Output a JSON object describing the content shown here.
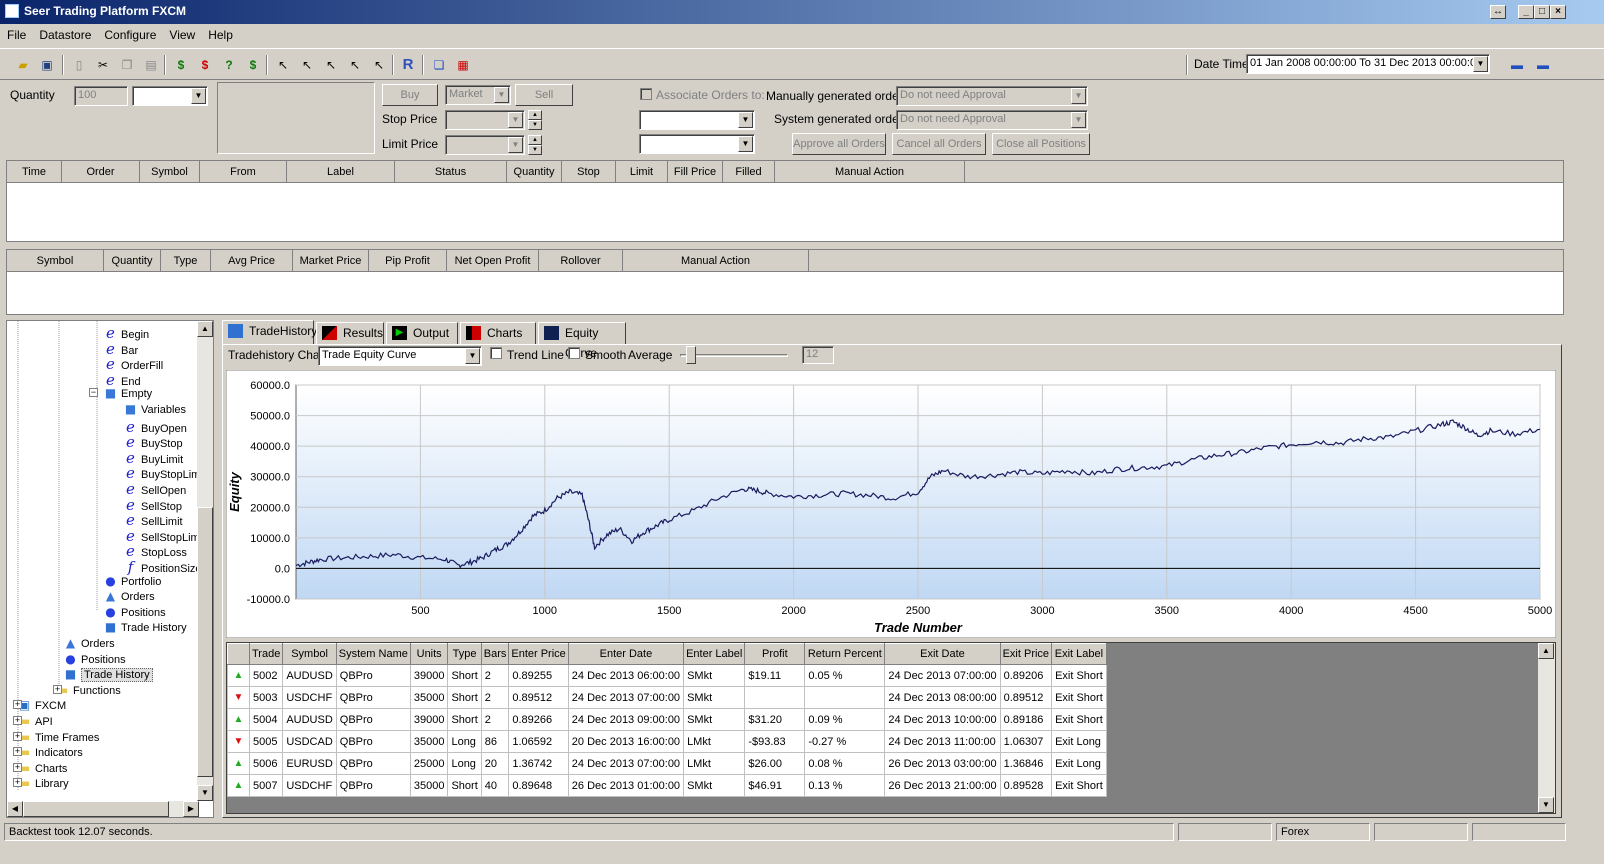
{
  "window": {
    "title": "Seer Trading Platform FXCM"
  },
  "menu": [
    "File",
    "Datastore",
    "Configure",
    "View",
    "Help"
  ],
  "datetime": {
    "label": "Date Time",
    "value": "01 Jan 2008 00:00:00 To 31 Dec 2013 00:00:00"
  },
  "order_entry": {
    "quantity_label": "Quantity",
    "quantity_value": "100",
    "buy_label": "Buy",
    "sell_label": "Sell",
    "order_type": "Market",
    "stop_price_label": "Stop Price",
    "limit_price_label": "Limit Price",
    "associate_label": "Associate Orders to:",
    "manual_label": "Manually generated orders",
    "manual_value": "Do not need Approval",
    "system_label": "System generated orders",
    "system_value": "Do not need Approval",
    "approve_label": "Approve all Orders",
    "cancel_label": "Cancel all Orders",
    "close_label": "Close all Positions"
  },
  "orders_grid": {
    "columns": [
      "Time",
      "Order",
      "Symbol",
      "From",
      "Label",
      "Status",
      "Quantity",
      "Stop",
      "Limit",
      "Fill Price",
      "Filled",
      "Manual Action"
    ]
  },
  "positions_grid": {
    "columns": [
      "Symbol",
      "Quantity",
      "Type",
      "Avg Price",
      "Market Price",
      "Pip Profit",
      "Net Open Profit",
      "Rollover",
      "Manual Action"
    ]
  },
  "tree": {
    "items": [
      {
        "label": "Begin",
        "icon": "e-script-icon"
      },
      {
        "label": "Bar",
        "icon": "e-script-icon"
      },
      {
        "label": "OrderFill",
        "icon": "e-script-icon"
      },
      {
        "label": "End",
        "icon": "e-script-icon"
      },
      {
        "label": "Empty",
        "icon": "cube-icon"
      },
      {
        "label": "Variables",
        "icon": "cube-icon"
      },
      {
        "label": "BuyOpen",
        "icon": "e-script-icon"
      },
      {
        "label": "BuyStop",
        "icon": "e-script-icon"
      },
      {
        "label": "BuyLimit",
        "icon": "e-script-icon"
      },
      {
        "label": "BuyStopLimi",
        "icon": "e-script-icon"
      },
      {
        "label": "SellOpen",
        "icon": "e-script-icon"
      },
      {
        "label": "SellStop",
        "icon": "e-script-icon"
      },
      {
        "label": "SellLimit",
        "icon": "e-script-icon"
      },
      {
        "label": "SellStopLimi",
        "icon": "e-script-icon"
      },
      {
        "label": "StopLoss",
        "icon": "e-script-icon"
      },
      {
        "label": "PositionSize",
        "icon": "f-function-icon"
      },
      {
        "label": "Portfolio",
        "icon": "sphere-icon"
      },
      {
        "label": "Orders",
        "icon": "triangle-icon"
      },
      {
        "label": "Positions",
        "icon": "sphere-icon"
      },
      {
        "label": "Trade History",
        "icon": "square-icon"
      },
      {
        "label": "Orders",
        "icon": "triangle-icon"
      },
      {
        "label": "Positions",
        "icon": "sphere-icon"
      },
      {
        "label": "Trade History",
        "icon": "square-icon"
      },
      {
        "label": "Functions",
        "icon": "folder-icon"
      },
      {
        "label": "FXCM",
        "icon": "fxcm-icon"
      },
      {
        "label": "API",
        "icon": "folder-icon"
      },
      {
        "label": "Time Frames",
        "icon": "folder-icon"
      },
      {
        "label": "Indicators",
        "icon": "folder-icon"
      },
      {
        "label": "Charts",
        "icon": "folder-icon"
      },
      {
        "label": "Library",
        "icon": "folder-icon"
      }
    ]
  },
  "tabs": [
    "TradeHistory",
    "Results",
    "Output",
    "Charts",
    "Equity Curve"
  ],
  "chart_options": {
    "chart_label": "Tradehistory Chart",
    "chart_value": "Trade Equity Curve",
    "trend_label": "Trend Line",
    "smooth_label": "Smooth",
    "average_label": "Average",
    "average_value": "12"
  },
  "chart_data": {
    "type": "line",
    "xlabel": "Trade Number",
    "ylabel": "Equity",
    "xlim": [
      0,
      5000
    ],
    "ylim": [
      -10000,
      60000
    ],
    "x_ticks": [
      "500",
      "1000",
      "1500",
      "2000",
      "2500",
      "3000",
      "3500",
      "4000",
      "4500",
      "5000"
    ],
    "y_ticks": [
      "60000.0",
      "50000.0",
      "40000.0",
      "30000.0",
      "20000.0",
      "10000.0",
      "0.0",
      "-10000.0"
    ],
    "series": [
      {
        "x": [
          0,
          50,
          100,
          200,
          300,
          400,
          500,
          600,
          650,
          700,
          750,
          800,
          850,
          900,
          950,
          1000,
          1050,
          1100,
          1150,
          1175,
          1200,
          1250,
          1300,
          1350,
          1400,
          1450,
          1500,
          1600,
          1700,
          1800,
          1850,
          1900,
          2000,
          2100,
          2200,
          2300,
          2400,
          2500,
          2550,
          2600,
          2700,
          2800,
          2900,
          3000,
          3100,
          3200,
          3300,
          3400,
          3500,
          3600,
          3700,
          3800,
          3900,
          4000,
          4100,
          4200,
          4300,
          4400,
          4500,
          4600,
          4650,
          4700,
          4750,
          4800,
          4900,
          5000
        ],
        "y": [
          1000,
          2000,
          3000,
          3500,
          4000,
          4500,
          3500,
          3000,
          1000,
          2000,
          3500,
          6000,
          8000,
          12000,
          17000,
          19000,
          23000,
          25000,
          24000,
          16000,
          7000,
          11000,
          13000,
          9000,
          12000,
          14000,
          16000,
          19000,
          23000,
          26000,
          25500,
          24500,
          23500,
          24000,
          24500,
          24000,
          23000,
          25000,
          30000,
          32000,
          30000,
          30500,
          31500,
          31000,
          32000,
          31000,
          32500,
          33000,
          33500,
          35500,
          37000,
          38000,
          39500,
          40500,
          41500,
          41000,
          42500,
          43000,
          45000,
          47000,
          48000,
          46000,
          43500,
          45000,
          44000,
          45500
        ]
      }
    ]
  },
  "trade_table": {
    "columns": [
      "Trade",
      "Symbol",
      "System Name",
      "Units",
      "Type",
      "Bars",
      "Enter Price",
      "Enter Date",
      "Enter Label",
      "Profit",
      "Return Percent",
      "Exit Date",
      "Exit Price",
      "Exit Label"
    ],
    "rows": [
      {
        "dir": "up",
        "cells": [
          "5002",
          "AUDUSD",
          "QBPro",
          "39000",
          "Short",
          "2",
          "0.89255",
          "24 Dec 2013 06:00:00",
          "SMkt",
          "$19.11",
          "0.05 %",
          "24 Dec 2013 07:00:00",
          "0.89206",
          "Exit Short"
        ]
      },
      {
        "dir": "down",
        "cells": [
          "5003",
          "USDCHF",
          "QBPro",
          "35000",
          "Short",
          "2",
          "0.89512",
          "24 Dec 2013 07:00:00",
          "SMkt",
          "",
          "",
          "24 Dec 2013 08:00:00",
          "0.89512",
          "Exit Short"
        ]
      },
      {
        "dir": "up",
        "cells": [
          "5004",
          "AUDUSD",
          "QBPro",
          "39000",
          "Short",
          "2",
          "0.89266",
          "24 Dec 2013 09:00:00",
          "SMkt",
          "$31.20",
          "0.09 %",
          "24 Dec 2013 10:00:00",
          "0.89186",
          "Exit Short"
        ]
      },
      {
        "dir": "down",
        "cells": [
          "5005",
          "USDCAD",
          "QBPro",
          "35000",
          "Long",
          "86",
          "1.06592",
          "20 Dec 2013 16:00:00",
          "LMkt",
          "-$93.83",
          "-0.27 %",
          "24 Dec 2013 11:00:00",
          "1.06307",
          "Exit Long"
        ]
      },
      {
        "dir": "up",
        "cells": [
          "5006",
          "EURUSD",
          "QBPro",
          "25000",
          "Long",
          "20",
          "1.36742",
          "24 Dec 2013 07:00:00",
          "LMkt",
          "$26.00",
          "0.08 %",
          "26 Dec 2013 03:00:00",
          "1.36846",
          "Exit Long"
        ]
      },
      {
        "dir": "up",
        "cells": [
          "5007",
          "USDCHF",
          "QBPro",
          "35000",
          "Short",
          "40",
          "0.89648",
          "26 Dec 2013 01:00:00",
          "SMkt",
          "$46.91",
          "0.13 %",
          "26 Dec 2013 21:00:00",
          "0.89528",
          "Exit Short"
        ]
      }
    ]
  },
  "status": {
    "message": "Backtest took 12.07 seconds.",
    "market": "Forex"
  },
  "colors": {
    "up_arrow": "#22aa22",
    "down_arrow": "#dd1111",
    "equity_line": "#1a1a5e",
    "chart_bg_top": "#ffffff",
    "chart_bg_bottom": "#c0d8f4"
  }
}
